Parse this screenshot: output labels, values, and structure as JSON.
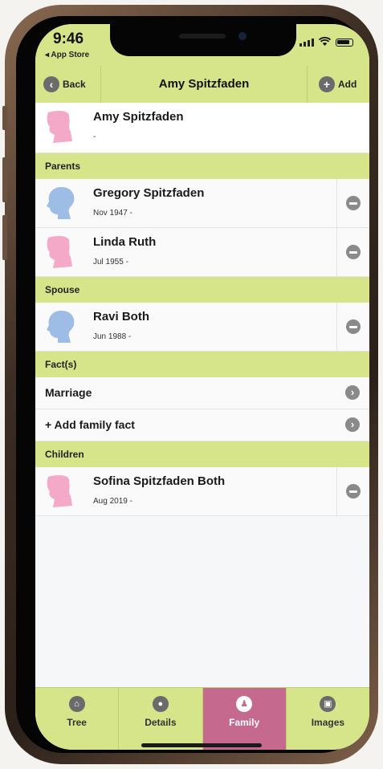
{
  "status": {
    "time": "9:46",
    "back_to_app": "◂ App Store"
  },
  "nav": {
    "back_label": "Back",
    "title": "Amy Spitzfaden",
    "add_label": "Add"
  },
  "colors": {
    "accent": "#d6e58a",
    "female": "#f4a9c8",
    "male": "#9dbde6",
    "active_tab": "#c5698e"
  },
  "main_person": {
    "name": "Amy Spitzfaden",
    "date": "-",
    "gender": "female"
  },
  "sections": {
    "parents": "Parents",
    "spouse": "Spouse",
    "facts": "Fact(s)",
    "children": "Children"
  },
  "parents": [
    {
      "name": "Gregory Spitzfaden",
      "date": "Nov 1947 -",
      "gender": "male"
    },
    {
      "name": "Linda Ruth",
      "date": "Jul 1955 -",
      "gender": "female"
    }
  ],
  "spouse": {
    "name": "Ravi Both",
    "date": "Jun 1988 -",
    "gender": "male"
  },
  "facts": [
    {
      "label": "Marriage"
    },
    {
      "label": "+ Add family fact"
    }
  ],
  "children": [
    {
      "name": "Sofina Spitzfaden Both",
      "date": "Aug 2019 -",
      "gender": "female"
    }
  ],
  "tabs": [
    {
      "label": "Tree",
      "icon": "home-icon"
    },
    {
      "label": "Details",
      "icon": "person-icon"
    },
    {
      "label": "Family",
      "icon": "family-icon",
      "active": true
    },
    {
      "label": "Images",
      "icon": "camera-icon"
    }
  ]
}
